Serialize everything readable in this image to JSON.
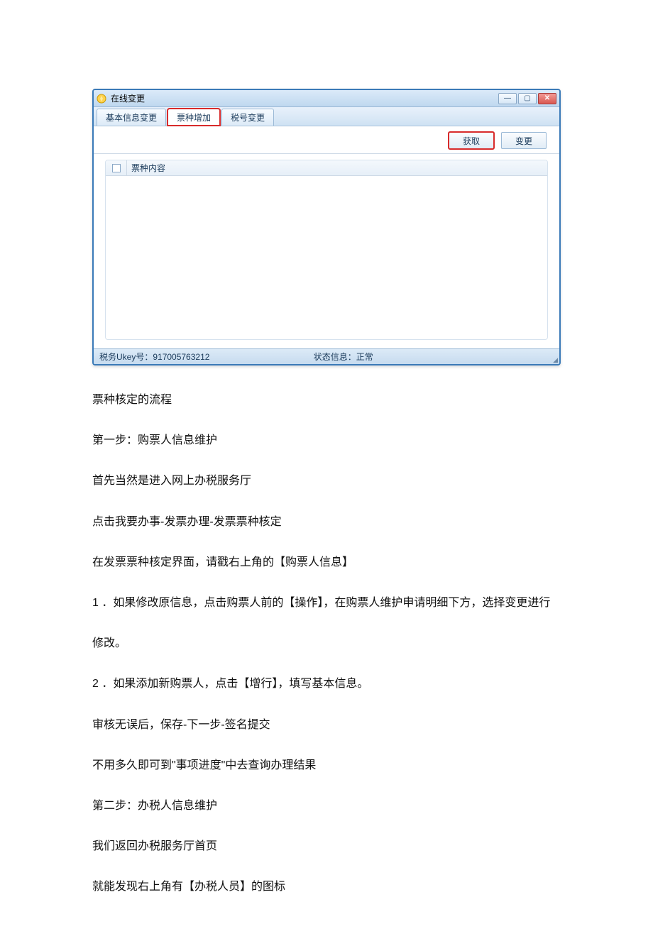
{
  "app": {
    "title": "在线变更",
    "tabs": [
      {
        "label": "基本信息变更",
        "active": false
      },
      {
        "label": "票种增加",
        "active": true
      },
      {
        "label": "税号变更",
        "active": false
      }
    ],
    "toolbar": {
      "fetch": "获取",
      "change": "变更"
    },
    "table": {
      "column_label": "票种内容"
    },
    "status": {
      "left_label": "税务Ukey号：",
      "ukey_number": "917005763212",
      "right_label": "状态信息：",
      "status_value": "正常"
    }
  },
  "doc": {
    "p1": "票种核定的流程",
    "p2": "第一步：购票人信息维护",
    "p3": "首先当然是进入网上办税服务厅",
    "p4": "点击我要办事-发票办理-发票票种核定",
    "p5": "在发票票种核定界面，请戳右上角的【购票人信息】",
    "p6": "1 ．如果修改原信息，点击购票人前的【操作】，在购票人维护申请明细下方，选择变更进行",
    "p7": "修改。",
    "p8": "2 ．如果添加新购票人，点击【增行】，填写基本信息。",
    "p9": "审核无误后，保存-下一步-签名提交",
    "p10": "不用多久即可到\"事项进度\"中去查询办理结果",
    "p11": "第二步：办税人信息维护",
    "p12": "我们返回办税服务厅首页",
    "p13": "就能发现右上角有【办税人员】的图标"
  }
}
